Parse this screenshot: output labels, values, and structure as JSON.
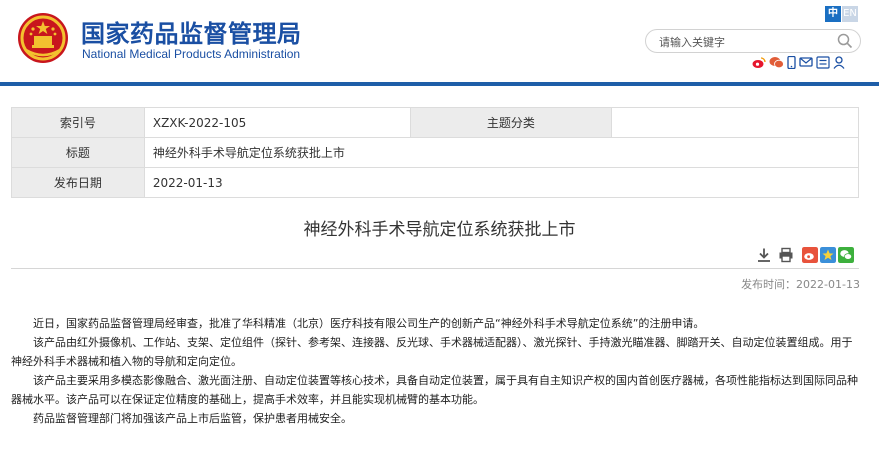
{
  "header": {
    "title_cn": "国家药品监督管理局",
    "title_en": "National Medical Products Administration",
    "lang_cn": "中",
    "lang_en": "EN",
    "search_placeholder": "请输入关键字",
    "social_icons": [
      "weibo-icon",
      "wechat-icon",
      "mobile-icon",
      "message-icon",
      "accessibility-icon",
      "user-icon"
    ]
  },
  "info_table": {
    "rows": [
      {
        "label1": "索引号",
        "value1": "XZXK-2022-105",
        "label2": "主题分类",
        "value2": ""
      },
      {
        "label1": "标题",
        "value1": "神经外科手术导航定位系统获批上市"
      },
      {
        "label1": "发布日期",
        "value1": "2022-01-13"
      }
    ]
  },
  "article": {
    "title": "神经外科手术导航定位系统获批上市",
    "tool_icons": [
      "download-icon",
      "print-icon",
      "weibo-share-icon",
      "star-share-icon",
      "wechat-share-icon"
    ],
    "publish_time": "发布时间：2022-01-13",
    "paragraphs": [
      "近日，国家药品监督管理局经审查，批准了华科精准（北京）医疗科技有限公司生产的创新产品“神经外科手术导航定位系统”的注册申请。",
      "该产品由红外摄像机、工作站、支架、定位组件（探针、参考架、连接器、反光球、手术器械适配器）、激光探针、手持激光瞄准器、脚踏开关、自动定位装置组成。用于神经外科手术器械和植入物的导航和定向定位。",
      "该产品主要采用多模态影像融合、激光面注册、自动定位装置等核心技术，具备自动定位装置，属于具有自主知识产权的国内首创医疗器械，各项性能指标达到国际同品种器械水平。该产品可以在保证定位精度的基础上，提高手术效率，并且能实现机械臂的基本功能。",
      "药品监督管理部门将加强该产品上市后监管，保护患者用械安全。"
    ]
  },
  "colors": {
    "brand_blue": "#1a4fa3",
    "bar_blue": "#1e5ea8",
    "label_bg": "#ececec"
  }
}
